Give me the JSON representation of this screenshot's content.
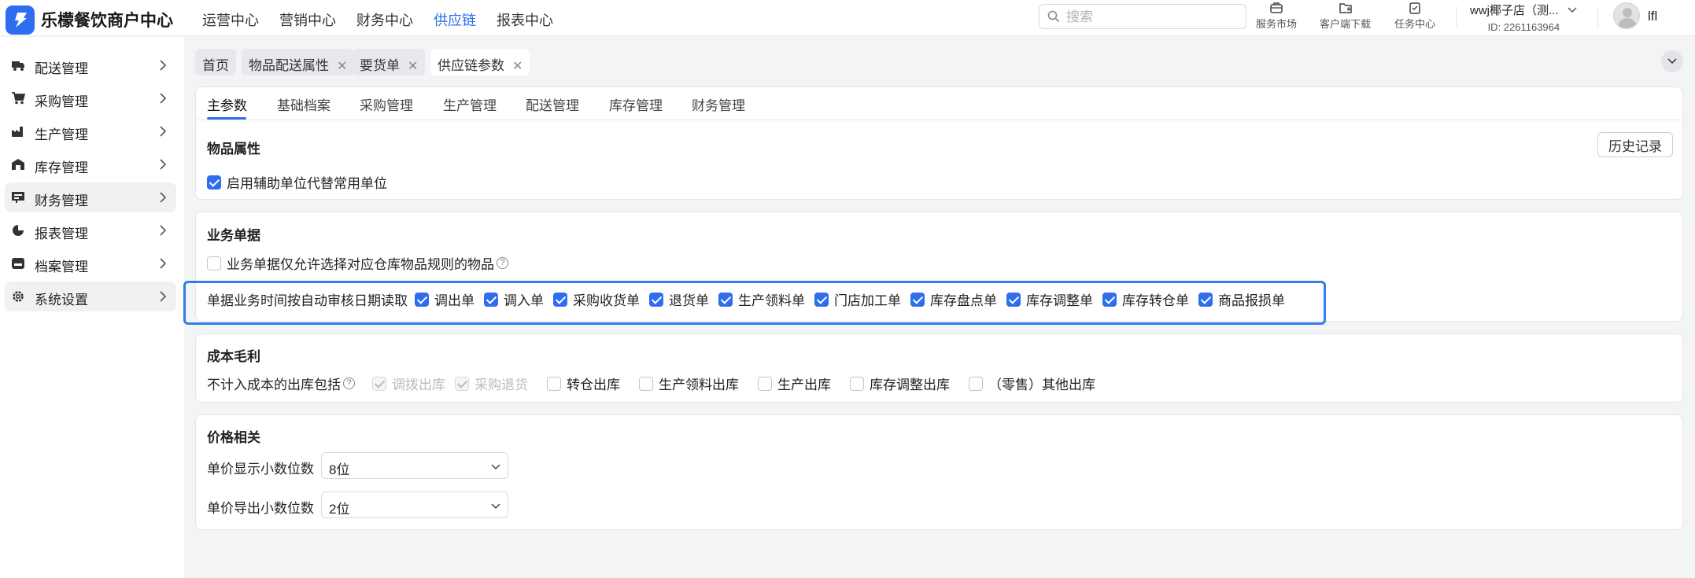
{
  "app": {
    "brand": "乐檬餐饮商户中心",
    "nav": [
      "运营中心",
      "营销中心",
      "财务中心",
      "供应链",
      "报表中心"
    ],
    "active_nav": "供应链",
    "search_placeholder": "搜索",
    "tools": [
      "服务市场",
      "客户端下载",
      "任务中心"
    ],
    "user_name": "wwj椰子店（测...",
    "user_id": "ID: 2261163964",
    "login_name": "lfl",
    "accent_color": "#2e6cf0"
  },
  "sidebar": {
    "items": [
      {
        "label": "配送管理",
        "icon": "truck-icon"
      },
      {
        "label": "采购管理",
        "icon": "cart-icon"
      },
      {
        "label": "生产管理",
        "icon": "factory-icon"
      },
      {
        "label": "库存管理",
        "icon": "warehouse-icon"
      },
      {
        "label": "财务管理",
        "icon": "finance-icon"
      },
      {
        "label": "报表管理",
        "icon": "report-icon"
      },
      {
        "label": "档案管理",
        "icon": "archive-icon"
      },
      {
        "label": "系统设置",
        "icon": "gear-icon"
      }
    ],
    "selected": [
      "财务管理",
      "系统设置"
    ]
  },
  "page_tabs": [
    {
      "label": "首页",
      "closable": false
    },
    {
      "label": "物品配送属性",
      "closable": true
    },
    {
      "label": "要货单",
      "closable": true
    },
    {
      "label": "供应链参数",
      "closable": true,
      "active": true
    }
  ],
  "sub_tabs": [
    "主参数",
    "基础档案",
    "采购管理",
    "生产管理",
    "配送管理",
    "库存管理",
    "财务管理"
  ],
  "active_sub_tab": "主参数",
  "history_button": "历史记录",
  "sections": {
    "item_props": {
      "title": "物品属性",
      "option": {
        "label": "启用辅助单位代替常用单位",
        "checked": true
      }
    },
    "business_docs": {
      "title": "业务单据",
      "option1": {
        "label": "业务单据仅允许选择对应仓库物品规则的物品",
        "checked": false
      },
      "auto_audit_label": "单据业务时间按自动审核日期读取",
      "auto_audit_items": [
        {
          "label": "调出单",
          "checked": true
        },
        {
          "label": "调入单",
          "checked": true
        },
        {
          "label": "采购收货单",
          "checked": true
        },
        {
          "label": "退货单",
          "checked": true
        },
        {
          "label": "生产领料单",
          "checked": true
        },
        {
          "label": "门店加工单",
          "checked": true
        },
        {
          "label": "库存盘点单",
          "checked": true
        },
        {
          "label": "库存调整单",
          "checked": true
        },
        {
          "label": "库存转仓单",
          "checked": true
        },
        {
          "label": "商品报损单",
          "checked": true
        }
      ]
    },
    "cost": {
      "title": "成本毛利",
      "exclude_label": "不计入成本的出库包括",
      "items": [
        {
          "label": "调拨出库",
          "checked": true,
          "disabled": true
        },
        {
          "label": "采购退货",
          "checked": true,
          "disabled": true
        },
        {
          "label": "转仓出库",
          "checked": false,
          "disabled": false
        },
        {
          "label": "生产领料出库",
          "checked": false,
          "disabled": false
        },
        {
          "label": "生产出库",
          "checked": false,
          "disabled": false
        },
        {
          "label": "库存调整出库",
          "checked": false,
          "disabled": false
        },
        {
          "label": "（零售）其他出库",
          "checked": false,
          "disabled": false
        }
      ]
    },
    "price": {
      "title": "价格相关",
      "unit_price_label": "单价显示小数位数",
      "unit_price_value": "8位",
      "export_label": "单价导出小数位数",
      "export_value": "2位"
    }
  }
}
